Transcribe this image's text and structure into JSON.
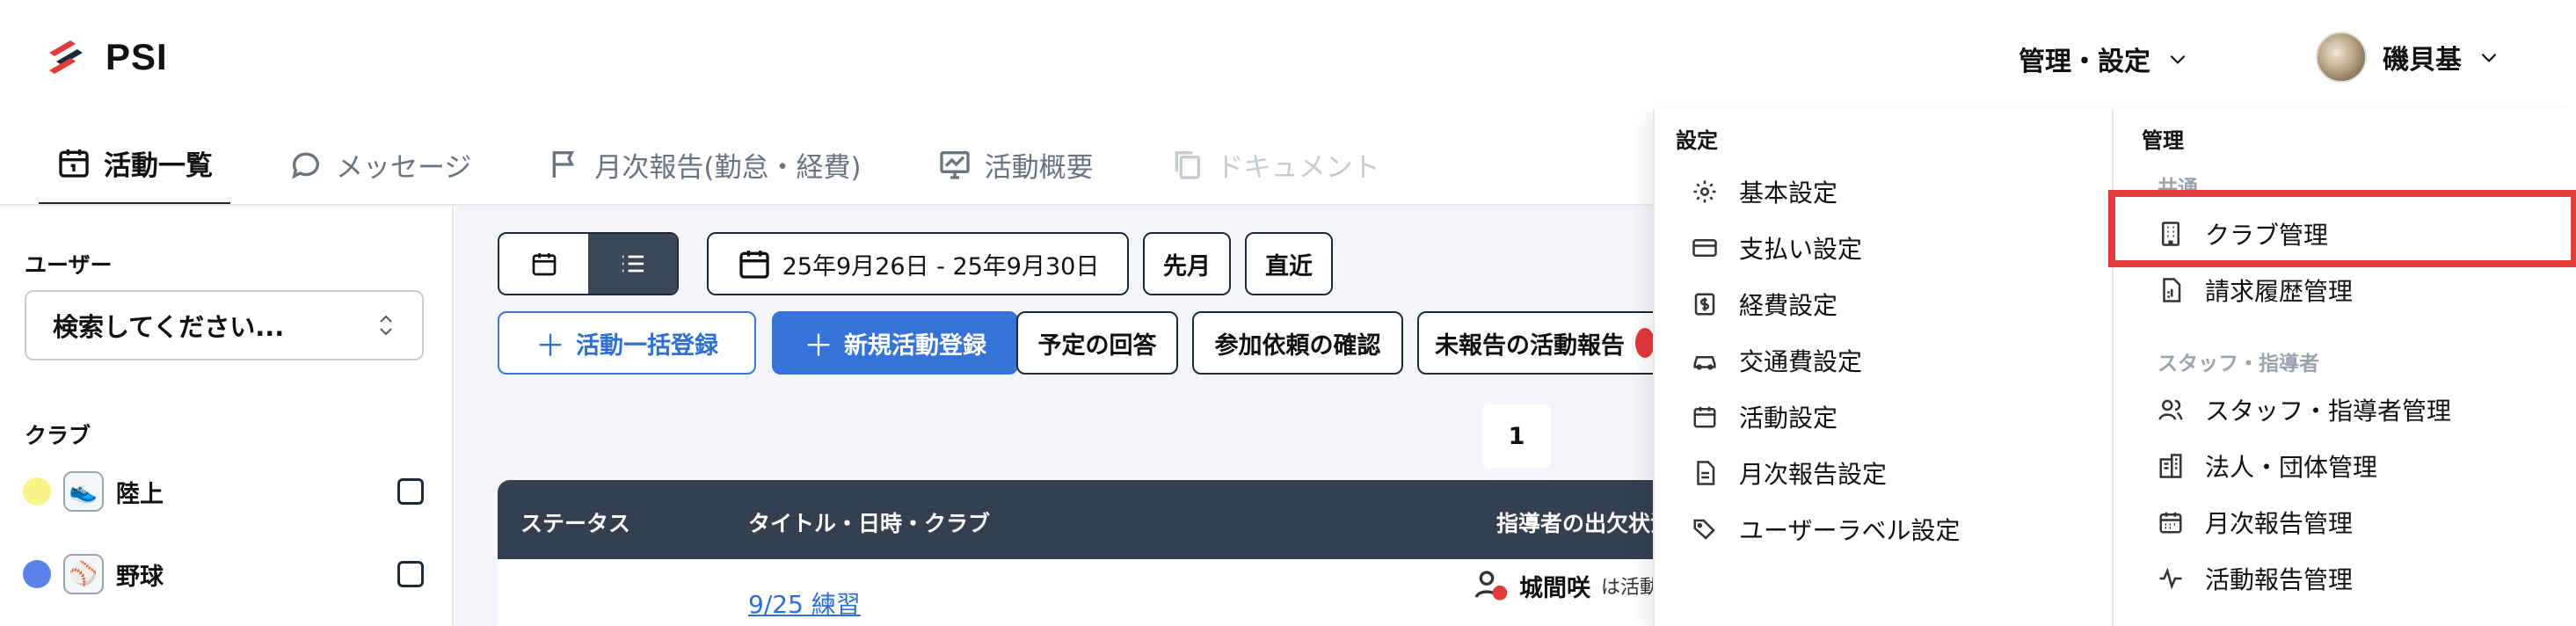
{
  "header": {
    "brand": "PSI",
    "admin_menu_label": "管理・設定",
    "user_name": "磯貝基"
  },
  "tabs": [
    {
      "label": "活動一覧",
      "icon": "calendar-icon",
      "state": "active"
    },
    {
      "label": "メッセージ",
      "icon": "chat-bubble-icon",
      "state": "normal"
    },
    {
      "label": "月次報告(勤怠・経費)",
      "icon": "flag-icon",
      "state": "normal"
    },
    {
      "label": "活動概要",
      "icon": "chart-monitor-icon",
      "state": "normal"
    },
    {
      "label": "ドキュメント",
      "icon": "copy-document-icon",
      "state": "disabled"
    }
  ],
  "sidebar": {
    "user_label": "ユーザー",
    "user_select_placeholder": "検索してください...",
    "club_label": "クラブ",
    "clubs": [
      {
        "name": "陸上",
        "dot_color": "#f7f58a",
        "icon": "running-shoe-icon",
        "checked": false
      },
      {
        "name": "野球",
        "dot_color": "#5b82e8",
        "icon": "baseball-icon",
        "checked": false
      }
    ]
  },
  "toolbar": {
    "date_range": "25年9月26日 - 25年9月30日",
    "last_month": "先月",
    "recent": "直近",
    "bulk_register": "活動一括登録",
    "new_activity": "新規活動登録",
    "schedule_response": "予定の回答",
    "confirm_participation": "参加依頼の確認",
    "unreported": "未報告の活動報告"
  },
  "pagination": {
    "current_page": "1"
  },
  "table": {
    "headers": {
      "status": "ステータス",
      "title": "タイトル・日時・クラブ",
      "coach_attendance": "指導者の出欠状況"
    },
    "rows": [
      {
        "title": "9/25 練習",
        "coach_name": "城間咲",
        "coach_status": "は活動"
      }
    ]
  },
  "dropdown": {
    "settings_heading": "設定",
    "settings_items": [
      {
        "label": "基本設定",
        "icon": "gear-icon"
      },
      {
        "label": "支払い設定",
        "icon": "credit-card-icon"
      },
      {
        "label": "経費設定",
        "icon": "dollar-receipt-icon"
      },
      {
        "label": "交通費設定",
        "icon": "car-icon"
      },
      {
        "label": "活動設定",
        "icon": "calendar-icon"
      },
      {
        "label": "月次報告設定",
        "icon": "document-icon"
      },
      {
        "label": "ユーザーラベル設定",
        "icon": "tags-icon"
      }
    ],
    "admin_heading": "管理",
    "common_sub": "共通",
    "common_items": [
      {
        "label": "クラブ管理",
        "icon": "building-icon",
        "highlighted": true
      },
      {
        "label": "請求履歴管理",
        "icon": "invoice-icon",
        "highlighted": false
      }
    ],
    "staff_sub": "スタッフ・指導者",
    "staff_items": [
      {
        "label": "スタッフ・指導者管理",
        "icon": "users-icon"
      },
      {
        "label": "法人・団体管理",
        "icon": "office-building-icon"
      },
      {
        "label": "月次報告管理",
        "icon": "calendar-grid-icon"
      },
      {
        "label": "活動報告管理",
        "icon": "activity-pulse-icon"
      }
    ]
  }
}
